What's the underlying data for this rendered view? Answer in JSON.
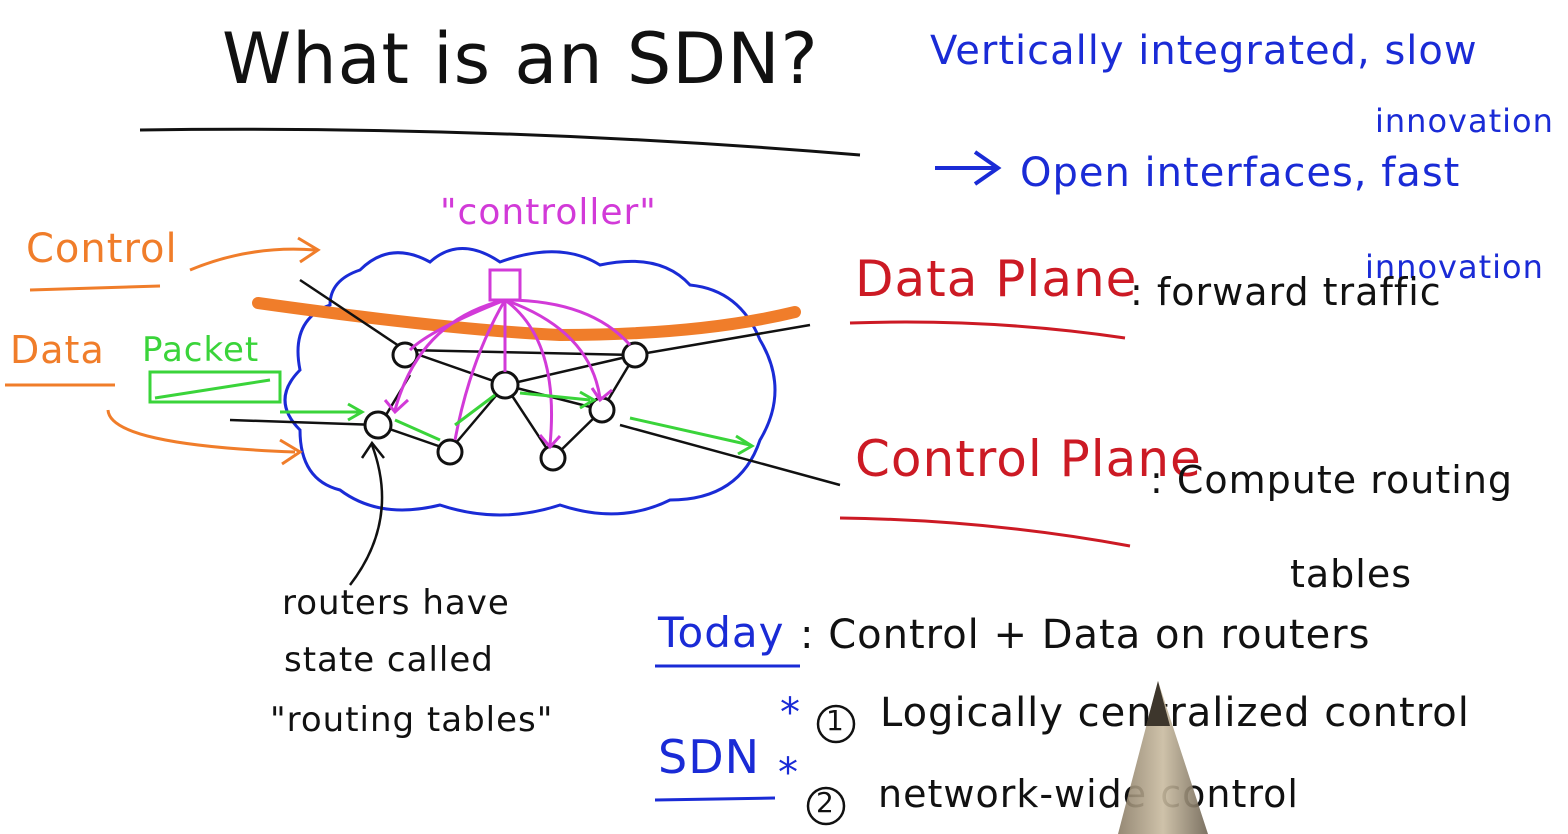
{
  "title": "What is an SDN?",
  "right_notes": {
    "vertical": "Vertically integrated, slow",
    "vertical_cont": "innovation",
    "open": "Open interfaces, fast",
    "open_cont": "innovation",
    "data_plane_label": "Data Plane",
    "data_plane_desc": ": forward traffic",
    "control_plane_label": "Control Plane",
    "control_plane_desc": ": Compute routing",
    "control_plane_desc_cont": "tables"
  },
  "diagram": {
    "controller_label": "\"controller\"",
    "control_label": "Control",
    "data_label": "Data",
    "packet_label": "Packet",
    "router_note_line1": "routers have",
    "router_note_line2": "state called",
    "router_note_line3": "\"routing tables\""
  },
  "bottom": {
    "today_label": "Today",
    "today_desc": ": Control + Data on routers",
    "sdn_label": "SDN",
    "point1": "Logically centralized control",
    "point2": "network-wide control",
    "num1": "1",
    "num2": "2",
    "star": "*"
  },
  "colors": {
    "ink_black": "#111111",
    "ink_blue": "#1a2bd6",
    "ink_red": "#cc1a24",
    "ink_orange": "#f07d2a",
    "ink_green": "#3ad43a",
    "ink_magenta": "#d23ad8",
    "cloud": "#1a2bd6"
  },
  "icons": [
    "arrow-right-icon",
    "router-node-icon",
    "cloud-outline-icon",
    "pencil-tip-icon"
  ]
}
